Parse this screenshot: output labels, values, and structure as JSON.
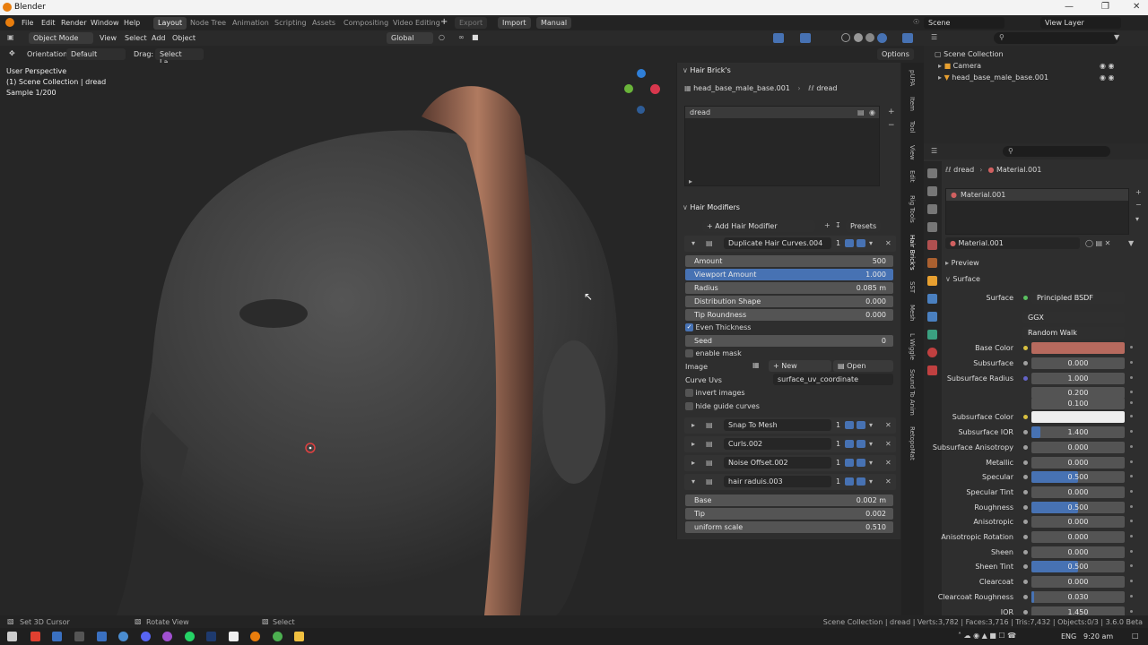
{
  "window": {
    "title": "Blender"
  },
  "menu": [
    "File",
    "Edit",
    "Render",
    "Window",
    "Help"
  ],
  "workspaces": [
    "Layout",
    "Node Tree",
    "Animation",
    "Scripting",
    "Assets",
    "Compositing",
    "Video Editing"
  ],
  "top_right": {
    "export": "Export",
    "import": "Import",
    "manual": "Manual",
    "scene": "Scene",
    "view_layer": "View Layer"
  },
  "header": {
    "mode": "Object Mode",
    "view": "View",
    "select": "Select",
    "add": "Add",
    "object": "Object",
    "transform": "Global"
  },
  "header2": {
    "orientation_label": "Orientation:",
    "orientation": "Default",
    "drag_label": "Drag:",
    "drag": "Select La...",
    "options": "Options"
  },
  "viewport": {
    "line1": "User Perspective",
    "line2": "(1) Scene Collection | dread",
    "line3": "Sample 1/200"
  },
  "npanel": {
    "title": "Hair Brick's",
    "object": "head_base_male_base.001",
    "hair": "dread",
    "list_item": "dread",
    "modifiers_title": "Hair Modifiers",
    "add_modifier": "Add Hair Modifier",
    "presets": "Presets",
    "mod1": {
      "name": "Duplicate Hair Curves.004",
      "count": "1",
      "props": [
        {
          "label": "Amount",
          "value": "500"
        },
        {
          "label": "Viewport Amount",
          "value": "1.000"
        },
        {
          "label": "Radius",
          "value": "0.085 m"
        },
        {
          "label": "Distribution Shape",
          "value": "0.000"
        },
        {
          "label": "Tip Roundness",
          "value": "0.000"
        }
      ],
      "even_thickness": "Even Thickness",
      "seed_label": "Seed",
      "seed": "0",
      "enable_mask": "enable mask",
      "image_label": "Image",
      "new": "New",
      "open": "Open",
      "curve_uvs_label": "Curve Uvs",
      "curve_uvs": "surface_uv_coordinate",
      "invert_images": "invert images",
      "hide_guide": "hide guide curves"
    },
    "collapsed_mods": [
      {
        "name": "Snap To Mesh",
        "count": "1"
      },
      {
        "name": "Curls.002",
        "count": "1"
      },
      {
        "name": "Noise Offset.002",
        "count": "1"
      }
    ],
    "mod5": {
      "name": "hair raduis.003",
      "count": "1",
      "props": [
        {
          "label": "Base",
          "value": "0.002 m"
        },
        {
          "label": "Tip",
          "value": "0.002"
        },
        {
          "label": "uniform scale",
          "value": "0.510"
        }
      ]
    }
  },
  "side_tabs": [
    "pUPA",
    "Item",
    "Tool",
    "View",
    "Edit",
    "Rig Tools",
    "Hair Brick's",
    "SST",
    "Mesh",
    "L Wiggle",
    "Sound To Anim",
    "RetopoMat"
  ],
  "outliner": {
    "root": "Scene Collection",
    "items": [
      "Camera",
      "head_base_male_base.001"
    ]
  },
  "props": {
    "breadcrumb_obj": "dread",
    "breadcrumb_mat": "Material.001",
    "slot": "Material.001",
    "material": "Material.001",
    "preview": "Preview",
    "surface_section": "Surface",
    "surface_label": "Surface",
    "surface": "Principled BSDF",
    "distribution": "GGX",
    "sss_method": "Random Walk",
    "rows": [
      {
        "label": "Base Color",
        "value": ""
      },
      {
        "label": "Subsurface",
        "value": "0.000"
      },
      {
        "label": "Subsurface Radius",
        "value": "1.000"
      },
      {
        "label": "",
        "value": "0.200"
      },
      {
        "label": "",
        "value": "0.100"
      },
      {
        "label": "Subsurface Color",
        "value": ""
      },
      {
        "label": "Subsurface IOR",
        "value": "1.400"
      },
      {
        "label": "Subsurface Anisotropy",
        "value": "0.000"
      },
      {
        "label": "Metallic",
        "value": "0.000"
      },
      {
        "label": "Specular",
        "value": "0.500"
      },
      {
        "label": "Specular Tint",
        "value": "0.000"
      },
      {
        "label": "Roughness",
        "value": "0.500"
      },
      {
        "label": "Anisotropic",
        "value": "0.000"
      },
      {
        "label": "Anisotropic Rotation",
        "value": "0.000"
      },
      {
        "label": "Sheen",
        "value": "0.000"
      },
      {
        "label": "Sheen Tint",
        "value": "0.500"
      },
      {
        "label": "Clearcoat",
        "value": "0.000"
      },
      {
        "label": "Clearcoat Roughness",
        "value": "0.030"
      },
      {
        "label": "IOR",
        "value": "1.450"
      }
    ]
  },
  "status": {
    "left1": "Set 3D Cursor",
    "left2": "Rotate View",
    "left3": "Select",
    "right": "Scene Collection | dread | Verts:3,782 | Faces:3,716 | Tris:7,432 | Objects:0/3 | 3.6.0 Beta"
  },
  "taskbar": {
    "lang": "ENG",
    "time": "9:20 am"
  },
  "colors": {
    "accent": "#4772b3",
    "base_color": "#b76a5e",
    "subsurface_color": "#eeeeee"
  }
}
